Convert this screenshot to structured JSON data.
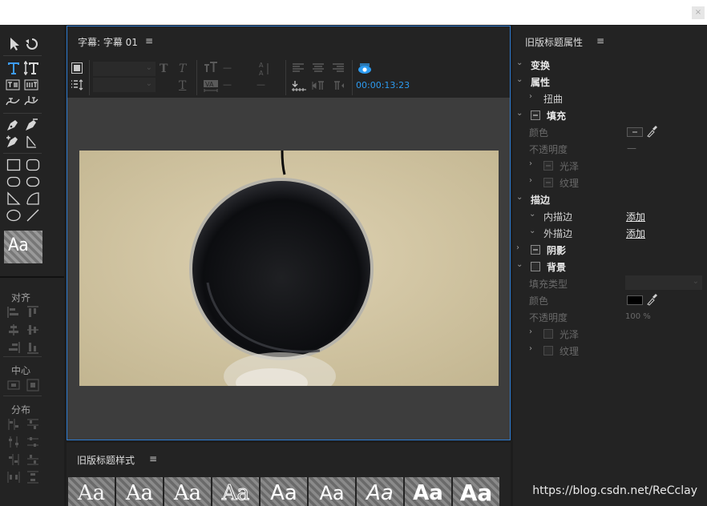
{
  "window": {
    "close_label": "×"
  },
  "tools_panel": {
    "align_label": "对齐",
    "center_label": "中心",
    "distribute_label": "分布",
    "style_swatch_text": "Aa"
  },
  "title_panel": {
    "tab_label": "字幕: 字幕 01",
    "menu_glyph": "≡",
    "timecode": "00:00:13:23",
    "tracking_value": "—",
    "kerning_value": "—",
    "leading_value": "—"
  },
  "styles_panel": {
    "title": "旧版标题样式",
    "menu_glyph": "≡",
    "thumbs": [
      "Aa",
      "Aa",
      "Aa",
      "Aa",
      "Aa",
      "Aa",
      "Aa",
      "Aa",
      "Aa"
    ]
  },
  "properties_panel": {
    "title": "旧版标题属性",
    "menu_glyph": "≡",
    "rows": {
      "transform": "变换",
      "properties": "属性",
      "distort": "扭曲",
      "fill": "填充",
      "fill_color": "颜色",
      "fill_opacity": "不透明度",
      "fill_opacity_value": "—",
      "sheen": "光泽",
      "texture": "纹理",
      "strokes": "描边",
      "inner_stroke": "内描边",
      "outer_stroke": "外描边",
      "add_label_1": "添加",
      "add_label_2": "添加",
      "shadow": "阴影",
      "background": "背景",
      "fill_type": "填充类型",
      "bg_color": "颜色",
      "bg_opacity": "不透明度",
      "bg_opacity_value": "100 %",
      "bg_sheen": "光泽",
      "bg_texture": "纹理"
    },
    "colors": {
      "bg_color_swatch": "#000000"
    }
  },
  "watermark": "https://blog.csdn.net/ReCclay"
}
